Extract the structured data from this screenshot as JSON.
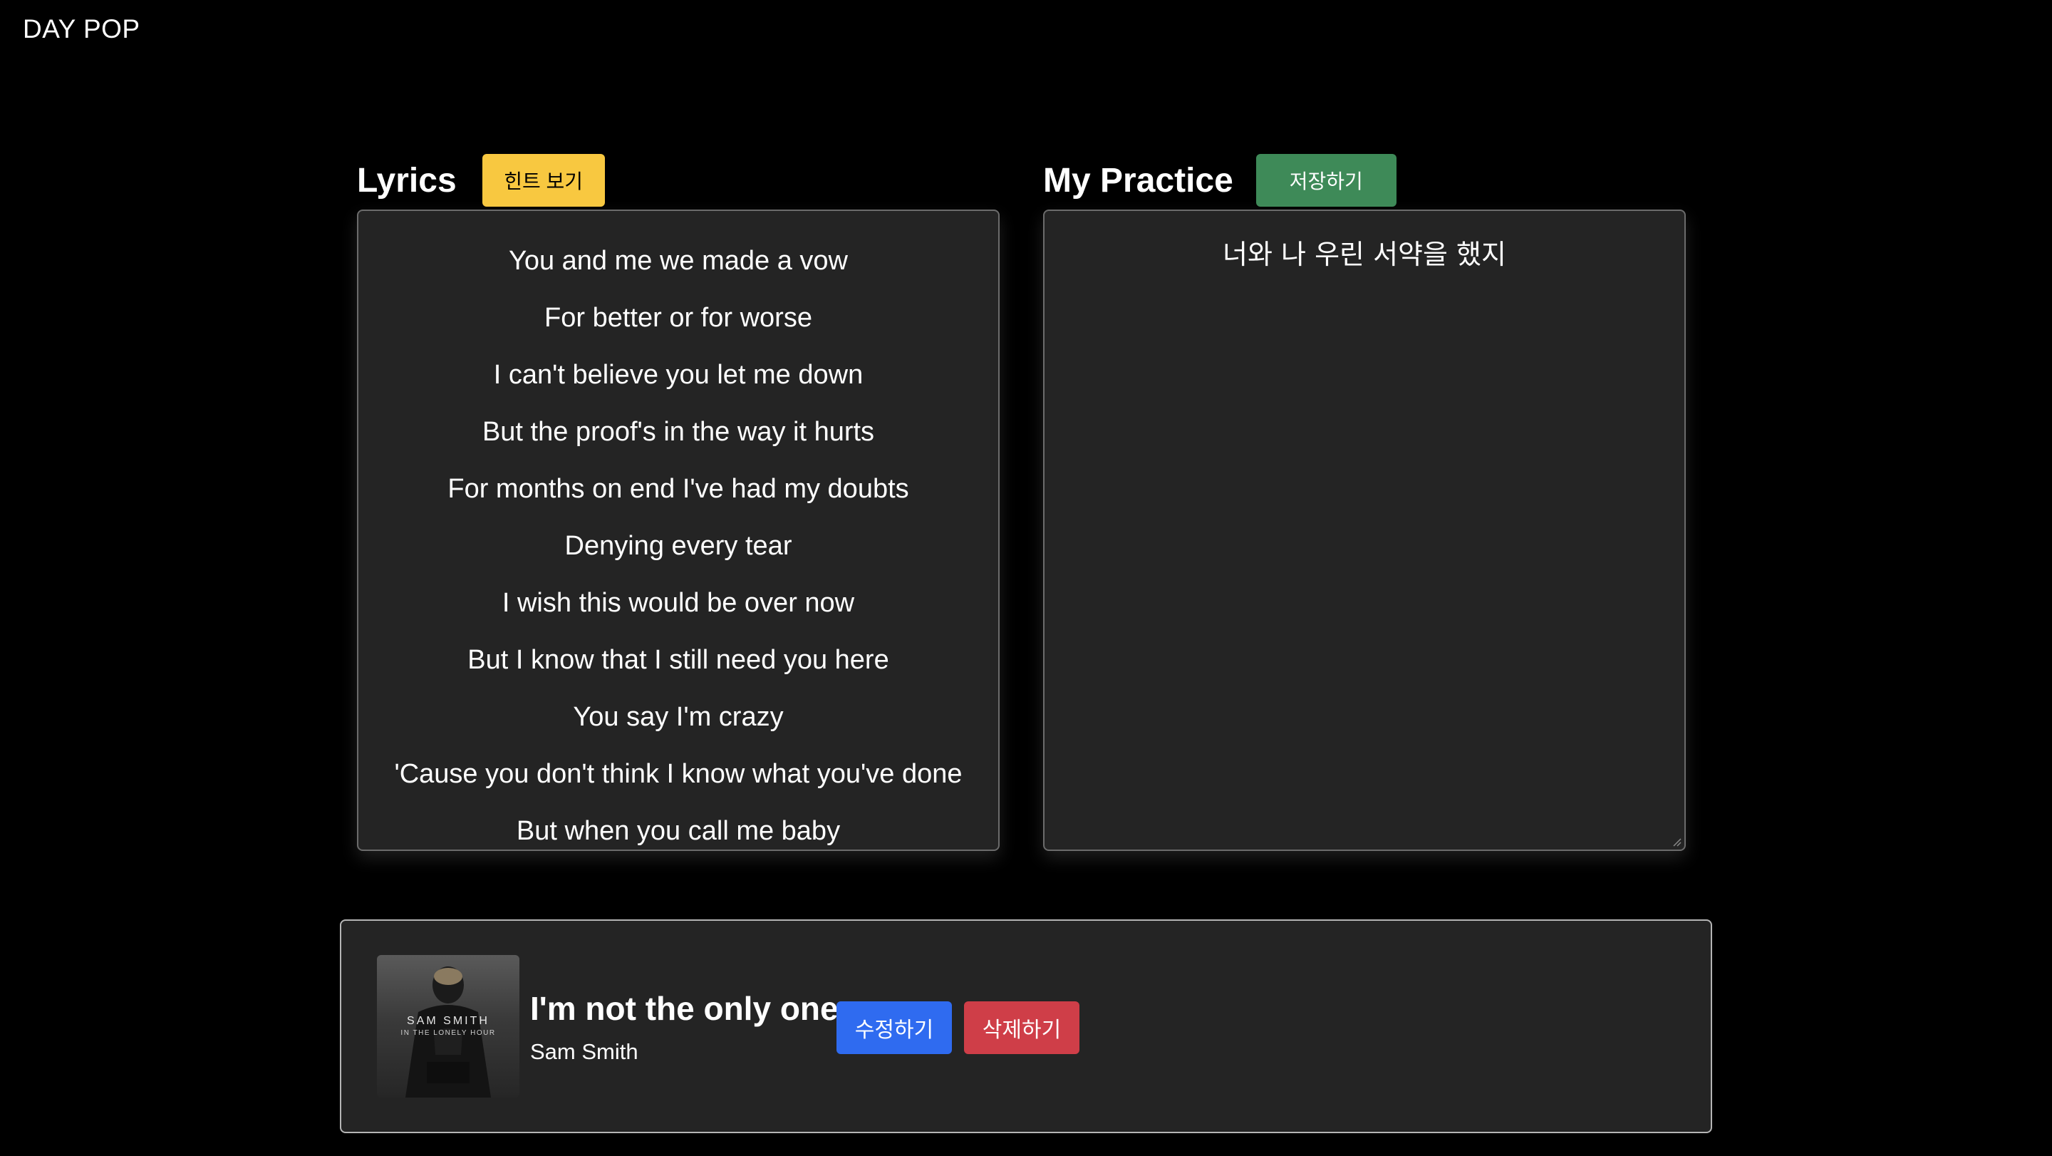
{
  "app": {
    "brand": "DAY POP"
  },
  "lyrics": {
    "title": "Lyrics",
    "hint_button": "힌트 보기",
    "lines": [
      "You and me we made a vow",
      "For better or for worse",
      "I can't believe you let me down",
      "But the proof's in the way it hurts",
      "For months on end I've had my doubts",
      "Denying every tear",
      "I wish this would be over now",
      "But I know that I still need you here",
      "You say I'm crazy",
      "'Cause you don't think I know what you've done",
      "But when you call me baby"
    ]
  },
  "practice": {
    "title": "My Practice",
    "save_button": "저장하기",
    "text": "너와 나 우린 서약을 했지"
  },
  "song": {
    "title": "I'm not the only one",
    "artist": "Sam Smith",
    "album_cover_text": "SAM SMITH",
    "album_cover_subtext": "IN THE LONELY HOUR",
    "edit_button": "수정하기",
    "delete_button": "삭제하기"
  },
  "colors": {
    "background": "#000000",
    "panel": "#242424",
    "hint": "#f8c840",
    "save": "#3e8a58",
    "edit": "#2f6bf0",
    "delete": "#cf3e48"
  }
}
